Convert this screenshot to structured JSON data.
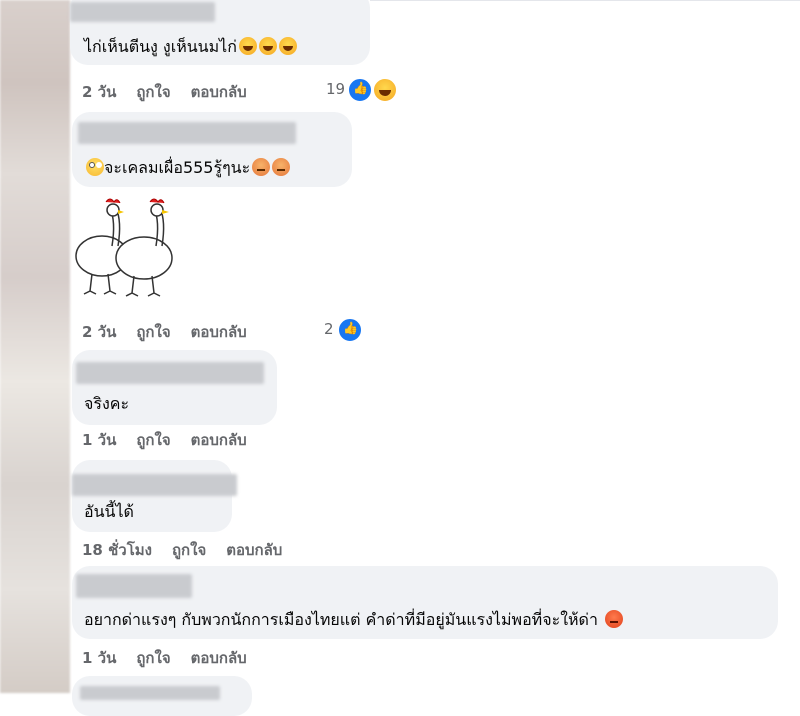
{
  "comments": [
    {
      "text": "ไก่เห็นตีนงู งูเห็นนมไก่",
      "time": "2 วัน",
      "like": "ถูกใจ",
      "reply": "ตอบกลับ",
      "reaction_count": "19",
      "reactions": [
        "like-icon",
        "haha-icon"
      ],
      "emojis": [
        "laughing-emoji",
        "laughing-emoji",
        "laughing-emoji"
      ]
    },
    {
      "text": "จะเคลมเผื่อ555รู้ๆนะ",
      "time": "2 วัน",
      "like": "ถูกใจ",
      "reply": "ตอบกลับ",
      "reaction_count": "2",
      "reactions": [
        "like-icon"
      ],
      "sticker": "two-chickens-sticker"
    },
    {
      "text": "จริงคะ",
      "time": "1 วัน",
      "like": "ถูกใจ",
      "reply": "ตอบกลับ"
    },
    {
      "text": "อันนี้ได้",
      "time": "18 ชั่วโมง",
      "like": "ถูกใจ",
      "reply": "ตอบกลับ"
    },
    {
      "text": "อยากด่าแรงๆ กับพวกนักการเมืองไทยแต่ คำด่าที่มีอยู่มันแรงไม่พอที่จะให้ด่า",
      "time": "1 วัน",
      "like": "ถูกใจ",
      "reply": "ตอบกลับ",
      "emojis": [
        "angry-emoji"
      ]
    }
  ],
  "colors": {
    "bubble": "#f0f2f5",
    "meta_text": "#65676b",
    "like_blue": "#1877f2"
  }
}
